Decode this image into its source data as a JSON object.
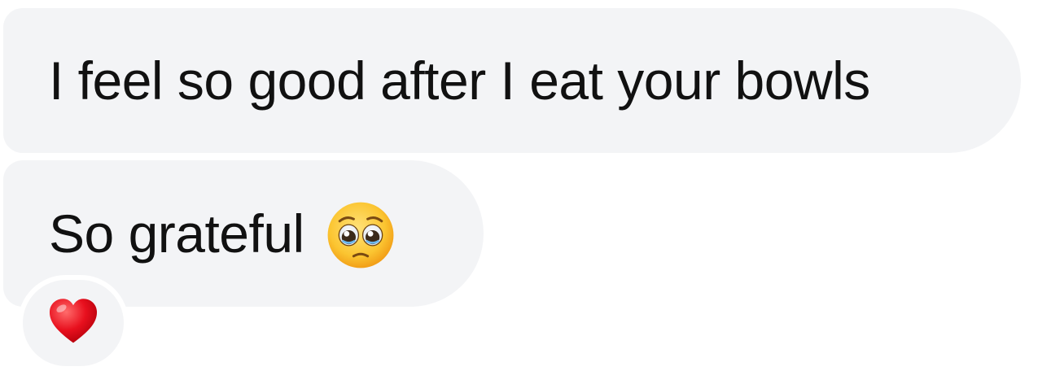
{
  "messages": [
    {
      "text": "I feel so good after I eat your bowls"
    },
    {
      "text": "So grateful",
      "emoji": "pleading-face-icon"
    }
  ],
  "reaction": {
    "emoji": "red-heart-icon"
  }
}
